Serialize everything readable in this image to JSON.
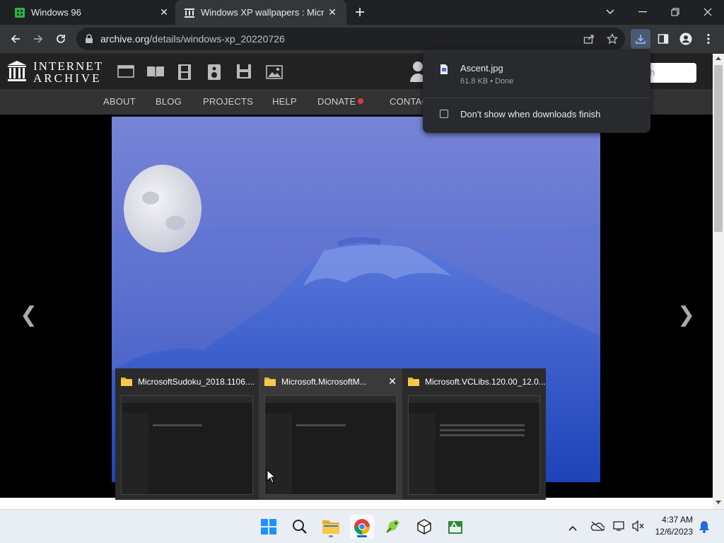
{
  "tabs": [
    {
      "title": "Windows 96",
      "active": false
    },
    {
      "title": "Windows XP wallpapers : Micros",
      "active": true
    }
  ],
  "toolbar": {
    "url_host": "archive.org",
    "url_path": "/details/windows-xp_20220726"
  },
  "site": {
    "logo_line1": "INTERNET",
    "logo_line2": "ARCHIVE",
    "search_placeholder": "h",
    "nav": [
      "ABOUT",
      "BLOG",
      "PROJECTS",
      "HELP",
      "DONATE",
      "CONTAC"
    ]
  },
  "downloads": {
    "filename": "Ascent.jpg",
    "meta": "61.8 KB • Done",
    "checkbox_label": "Don't show when downloads finish"
  },
  "previews": [
    {
      "title": "MicrosoftSudoku_2018.1106....",
      "closable": false
    },
    {
      "title": "Microsoft.MicrosoftM...",
      "closable": true
    },
    {
      "title": "Microsoft.VCLibs.120.00_12.0...",
      "closable": false
    }
  ],
  "clock": {
    "time": "4:37 AM",
    "date": "12/6/2023"
  },
  "colors": {
    "accent": "#8ab4f8",
    "taskbar": "#e9eef4",
    "donate_dot": "#e03a3a"
  }
}
